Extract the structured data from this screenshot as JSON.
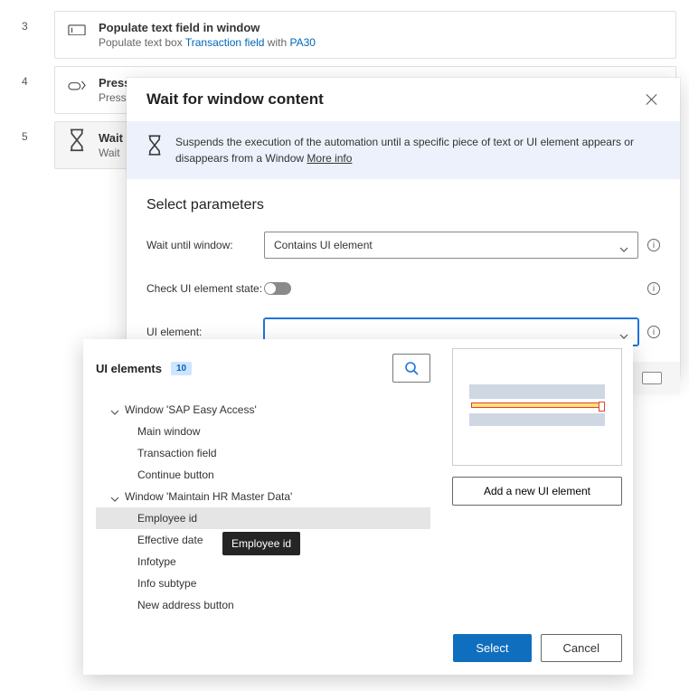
{
  "steps": {
    "s3": {
      "num": "3",
      "title": "Populate text field in window",
      "subtitle_prefix": "Populate text box ",
      "link1": "Transaction field",
      "mid": " with ",
      "link2": "PA30"
    },
    "s4": {
      "num": "4",
      "title": "Press button in window",
      "subtitle": "Press"
    },
    "s5": {
      "num": "5",
      "title": "Wait",
      "subtitle": "Wait"
    }
  },
  "dialog": {
    "title": "Wait for window content",
    "banner": "Suspends the execution of the automation until a specific piece of text or UI element appears or disappears from a Window ",
    "more_info": "More info",
    "params_heading": "Select parameters",
    "label_wait": "Wait until window:",
    "value_wait": "Contains UI element",
    "label_check": "Check UI element state:",
    "label_uielem": "UI element:"
  },
  "ui_popup": {
    "heading": "UI elements",
    "count": "10",
    "tree": {
      "parent1": "Window 'SAP Easy Access'",
      "p1_c1": "Main window",
      "p1_c2": "Transaction field",
      "p1_c3": "Continue button",
      "parent2": "Window 'Maintain HR Master Data'",
      "p2_c1": "Employee id",
      "p2_c2": "Effective date",
      "p2_c3": "Infotype",
      "p2_c4": "Info subtype",
      "p2_c5": "New address button"
    },
    "tooltip": "Employee id",
    "add_btn": "Add a new UI element",
    "select_btn": "Select",
    "cancel_btn": "Cancel"
  }
}
